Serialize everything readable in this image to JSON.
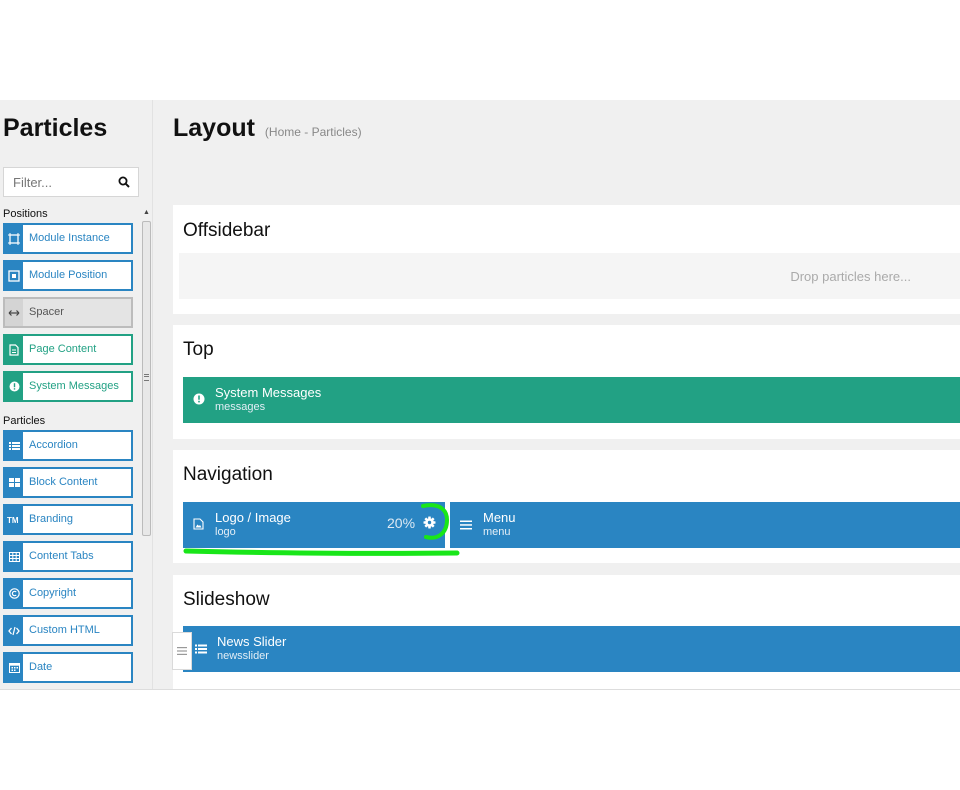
{
  "sidebar": {
    "title": "Particles",
    "filter_placeholder": "Filter...",
    "positions_label": "Positions",
    "positions": [
      {
        "label": "Module Instance",
        "icon": "module-instance-icon",
        "color": "#2a85c2"
      },
      {
        "label": "Module Position",
        "icon": "module-position-icon",
        "color": "#2a85c2"
      },
      {
        "label": "Spacer",
        "icon": "spacer-icon",
        "color": "#bcbcbc"
      },
      {
        "label": "Page Content",
        "icon": "document-icon",
        "color": "#22a184"
      },
      {
        "label": "System Messages",
        "icon": "exclamation-icon",
        "color": "#22a184"
      }
    ],
    "particles_label": "Particles",
    "particles": [
      {
        "label": "Accordion",
        "icon": "list-icon"
      },
      {
        "label": "Block Content",
        "icon": "grid-icon"
      },
      {
        "label": "Branding",
        "icon": "trademark-icon"
      },
      {
        "label": "Content Tabs",
        "icon": "table-icon"
      },
      {
        "label": "Copyright",
        "icon": "copyright-icon"
      },
      {
        "label": "Custom HTML",
        "icon": "code-icon"
      },
      {
        "label": "Date",
        "icon": "calendar-icon"
      }
    ]
  },
  "main": {
    "title": "Layout",
    "breadcrumb": "(Home - Particles)",
    "sections": {
      "offsidebar": {
        "title": "Offsidebar",
        "drop_text": "Drop particles here..."
      },
      "top": {
        "title": "Top",
        "block": {
          "name": "System Messages",
          "sub": "messages"
        }
      },
      "navigation": {
        "title": "Navigation",
        "logo": {
          "name": "Logo / Image",
          "sub": "logo",
          "width_pct": "20%"
        },
        "menu": {
          "name": "Menu",
          "sub": "menu"
        }
      },
      "slideshow": {
        "title": "Slideshow",
        "block": {
          "name": "News Slider",
          "sub": "newsslider"
        }
      }
    }
  },
  "colors": {
    "blue": "#2a85c2",
    "green": "#22a184",
    "annotation": "#19e619"
  }
}
